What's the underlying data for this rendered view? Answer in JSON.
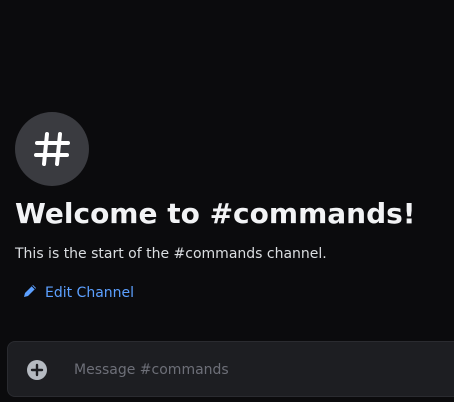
{
  "channel": {
    "icon": "hash-icon",
    "welcome_title": "Welcome to #commands!",
    "welcome_subtitle": "This is the start of the #commands channel."
  },
  "actions": {
    "edit_channel_icon": "pencil-icon",
    "edit_channel_label": "Edit Channel"
  },
  "composer": {
    "attach_icon": "plus-circle-icon",
    "placeholder": "Message #commands",
    "value": ""
  },
  "colors": {
    "background": "#0b0b0d",
    "link": "#5ca0ff",
    "icon_circle": "#3a3b40",
    "composer_bg": "#1d1e22"
  }
}
